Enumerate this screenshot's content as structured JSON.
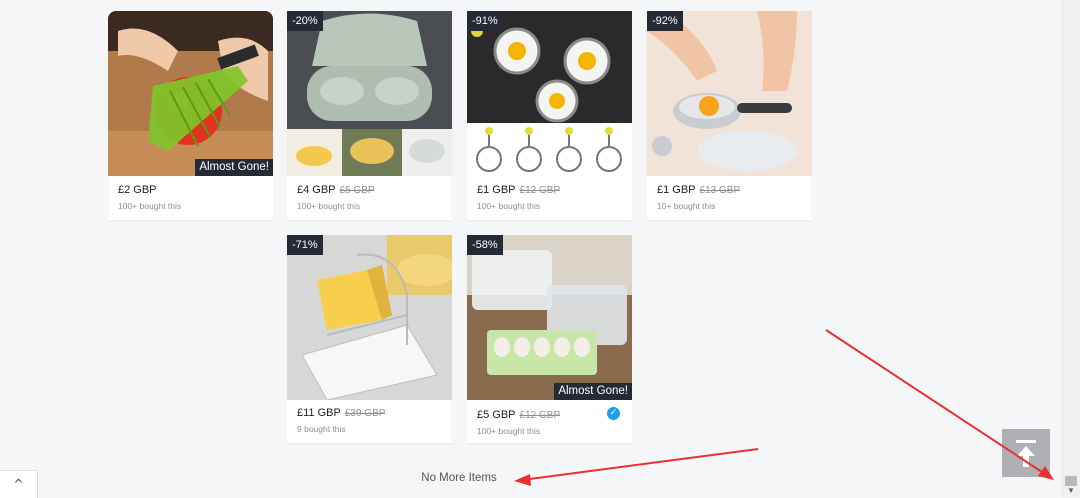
{
  "products": [
    {
      "discount": "",
      "badge": "Almost Gone!",
      "price": "£2 GBP",
      "old_price": "",
      "bought": "100+ bought this"
    },
    {
      "discount": "-20%",
      "badge": "",
      "price": "£4 GBP",
      "old_price": "£5 GBP",
      "bought": "100+ bought this"
    },
    {
      "discount": "-91%",
      "badge": "",
      "price": "£1 GBP",
      "old_price": "£12 GBP",
      "bought": "100+ bought this"
    },
    {
      "discount": "-92%",
      "badge": "",
      "price": "£1 GBP",
      "old_price": "£13 GBP",
      "bought": "10+ bought this"
    },
    {
      "discount": "-71%",
      "badge": "",
      "price": "£11 GBP",
      "old_price": "£39 GBP",
      "bought": "9 bought this"
    },
    {
      "discount": "-58%",
      "badge": "Almost Gone!",
      "price": "£5 GBP",
      "old_price": "£12 GBP",
      "bought": "100+ bought this"
    }
  ],
  "footer": {
    "no_more_items": "No More Items"
  },
  "icons": {
    "back_to_top": "arrow-up-to-line-icon",
    "verified": "check-circle-icon",
    "collapse": "chevron-up-icon"
  },
  "colors": {
    "badge_bg": "#252a35",
    "annotation_arrow": "#e8312f",
    "verified": "#1ea0e8"
  }
}
